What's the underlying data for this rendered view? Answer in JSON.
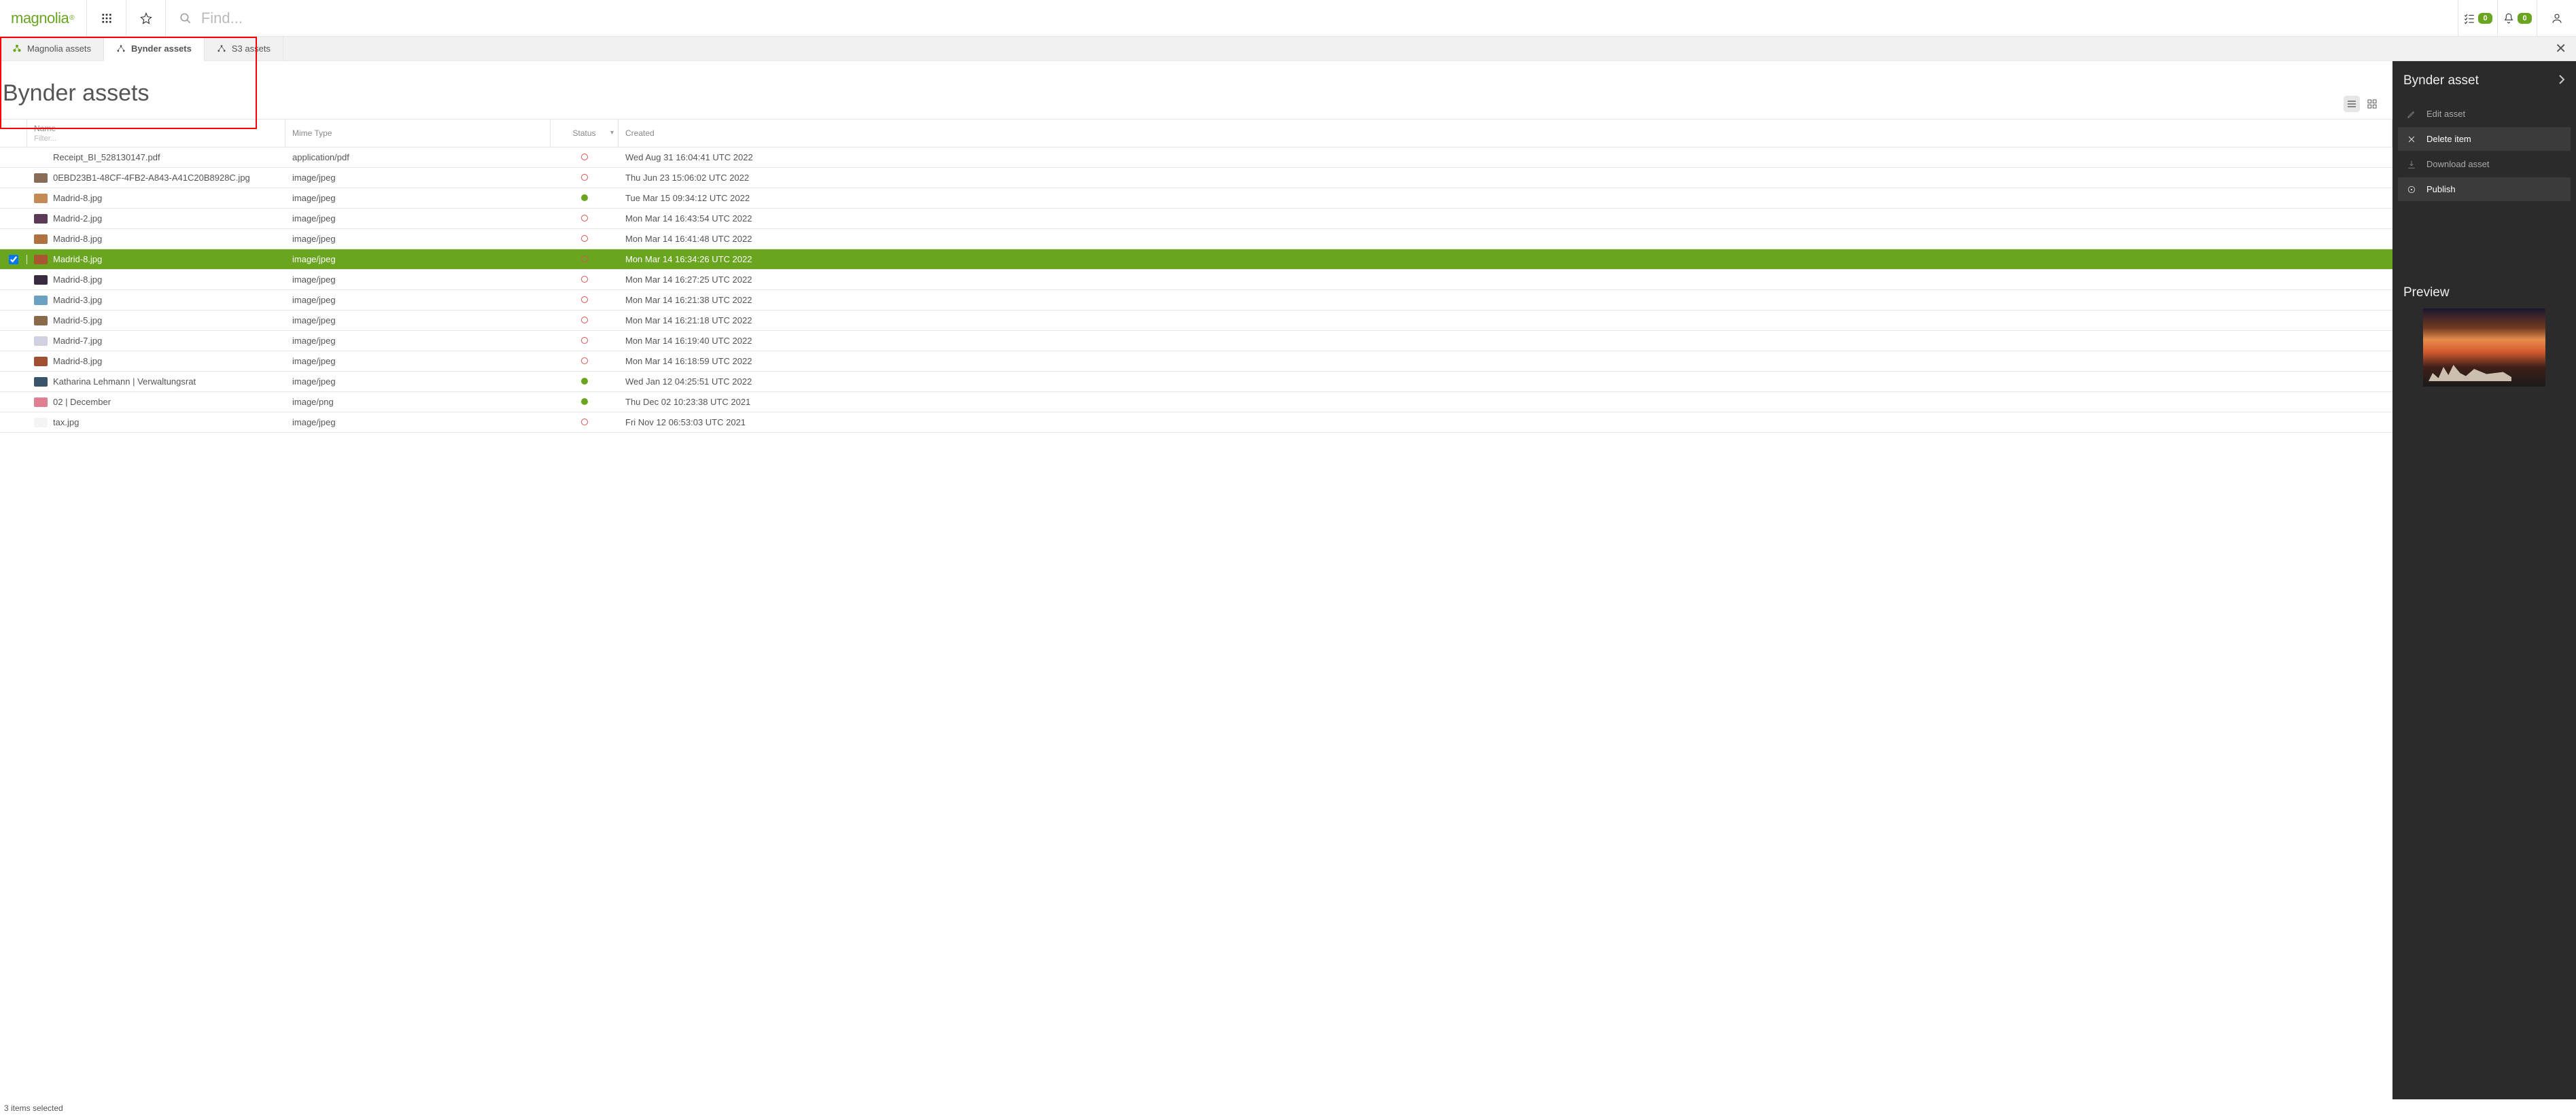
{
  "brand": "magnolia",
  "search": {
    "placeholder": "Find..."
  },
  "badges": {
    "tasks": "0",
    "notifications": "0"
  },
  "tabs": [
    {
      "id": "magnolia-assets",
      "label": "Magnolia assets",
      "active": false
    },
    {
      "id": "bynder-assets",
      "label": "Bynder assets",
      "active": true
    },
    {
      "id": "s3-assets",
      "label": "S3 assets",
      "active": false
    }
  ],
  "page_title": "Bynder assets",
  "columns": {
    "name": "Name",
    "filter_placeholder": "Filter...",
    "mime": "Mime Type",
    "status": "Status",
    "created": "Created"
  },
  "rows": [
    {
      "name": "Receipt_BI_528130147.pdf",
      "mime": "application/pdf",
      "status": "red",
      "created": "Wed Aug 31 16:04:41 UTC 2022",
      "thumb": "#ffffff",
      "selected": false
    },
    {
      "name": "0EBD23B1-48CF-4FB2-A843-A41C20B8928C.jpg",
      "mime": "image/jpeg",
      "status": "red",
      "created": "Thu Jun 23 15:06:02 UTC 2022",
      "thumb": "#8a6b55",
      "selected": false
    },
    {
      "name": "Madrid-8.jpg",
      "mime": "image/jpeg",
      "status": "green",
      "created": "Tue Mar 15 09:34:12 UTC 2022",
      "thumb": "#c48a55",
      "selected": false
    },
    {
      "name": "Madrid-2.jpg",
      "mime": "image/jpeg",
      "status": "red",
      "created": "Mon Mar 14 16:43:54 UTC 2022",
      "thumb": "#5a3a55",
      "selected": false
    },
    {
      "name": "Madrid-8.jpg",
      "mime": "image/jpeg",
      "status": "red",
      "created": "Mon Mar 14 16:41:48 UTC 2022",
      "thumb": "#b07040",
      "selected": false
    },
    {
      "name": "Madrid-8.jpg",
      "mime": "image/jpeg",
      "status": "red",
      "created": "Mon Mar 14 16:34:26 UTC 2022",
      "thumb": "#a85530",
      "selected": true
    },
    {
      "name": "Madrid-8.jpg",
      "mime": "image/jpeg",
      "status": "red",
      "created": "Mon Mar 14 16:27:25 UTC 2022",
      "thumb": "#3a2a40",
      "selected": false
    },
    {
      "name": "Madrid-3.jpg",
      "mime": "image/jpeg",
      "status": "red",
      "created": "Mon Mar 14 16:21:38 UTC 2022",
      "thumb": "#6aa0c0",
      "selected": false
    },
    {
      "name": "Madrid-5.jpg",
      "mime": "image/jpeg",
      "status": "red",
      "created": "Mon Mar 14 16:21:18 UTC 2022",
      "thumb": "#8a6a4a",
      "selected": false
    },
    {
      "name": "Madrid-7.jpg",
      "mime": "image/jpeg",
      "status": "red",
      "created": "Mon Mar 14 16:19:40 UTC 2022",
      "thumb": "#d0d0e0",
      "selected": false
    },
    {
      "name": "Madrid-8.jpg",
      "mime": "image/jpeg",
      "status": "red",
      "created": "Mon Mar 14 16:18:59 UTC 2022",
      "thumb": "#a05030",
      "selected": false
    },
    {
      "name": "Katharina Lehmann | Verwaltungsrat",
      "mime": "image/jpeg",
      "status": "green",
      "created": "Wed Jan 12 04:25:51 UTC 2022",
      "thumb": "#3a556a",
      "selected": false
    },
    {
      "name": "02 | December",
      "mime": "image/png",
      "status": "green",
      "created": "Thu Dec 02 10:23:38 UTC 2021",
      "thumb": "#e08090",
      "selected": false
    },
    {
      "name": "tax.jpg",
      "mime": "image/jpeg",
      "status": "red",
      "created": "Fri Nov 12 06:53:03 UTC 2021",
      "thumb": "#f4f4f4",
      "selected": false
    }
  ],
  "footer_status": "3 items selected",
  "side_panel": {
    "title": "Bynder asset",
    "actions": {
      "edit": "Edit asset",
      "delete": "Delete item",
      "download": "Download asset",
      "publish": "Publish"
    },
    "preview_label": "Preview"
  }
}
